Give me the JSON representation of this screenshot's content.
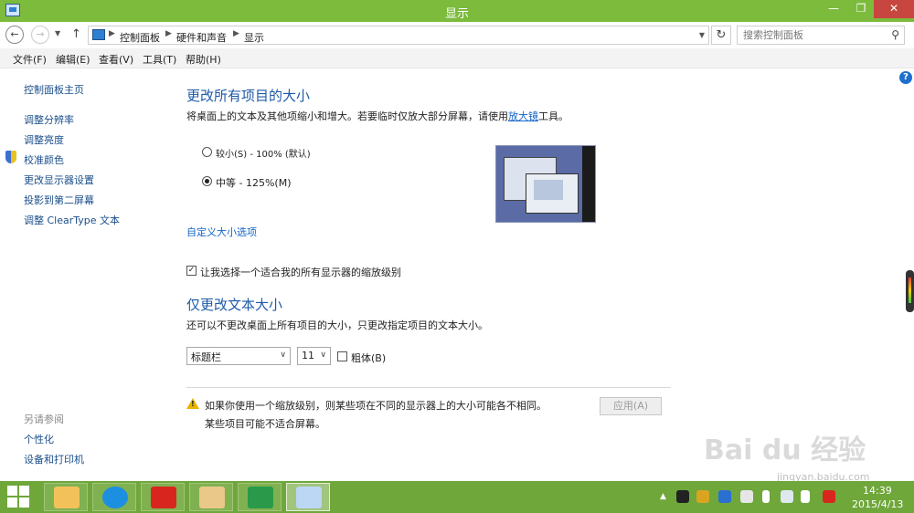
{
  "window": {
    "title": "显示",
    "minimize_glyph": "—",
    "maximize_glyph": "❐",
    "close_glyph": "✕"
  },
  "addressbar": {
    "breadcrumbs": [
      "控制面板",
      "硬件和声音",
      "显示"
    ],
    "search_placeholder": "搜索控制面板"
  },
  "menubar": {
    "items": [
      "文件(F)",
      "编辑(E)",
      "查看(V)",
      "工具(T)",
      "帮助(H)"
    ]
  },
  "sidebar": {
    "home": "控制面板主页",
    "items": [
      "调整分辨率",
      "调整亮度",
      "校准颜色",
      "更改显示器设置",
      "投影到第二屏幕",
      "调整 ClearType 文本"
    ],
    "see_also_title": "另请参阅",
    "see_also": [
      "个性化",
      "设备和打印机"
    ]
  },
  "main": {
    "section1_title": "更改所有项目的大小",
    "section1_desc_prefix": "将桌面上的文本及其他项缩小和增大。若要临时仅放大部分屏幕，请使用",
    "section1_desc_link": "放大镜",
    "section1_desc_suffix": "工具。",
    "option_small": "较小(S) - 100% (默认)",
    "option_medium": "中等 - 125%(M)",
    "selected_option": "medium",
    "custom_link": "自定义大小选项",
    "checkbox_label": "让我选择一个适合我的所有显示器的缩放级别",
    "checkbox_checked": true,
    "section2_title": "仅更改文本大小",
    "section2_desc": "还可以不更改桌面上所有项目的大小，只更改指定项目的文本大小。",
    "item_select_value": "标题栏",
    "size_select_value": "11",
    "bold_label": "粗体(B)",
    "bold_checked": false,
    "warning_line1": "如果你使用一个缩放级别，则某些项在不同的显示器上的大小可能各不相同。",
    "warning_line2": "某些项目可能不适合屏幕。",
    "apply_label": "应用(A)"
  },
  "taskbar": {
    "time": "14:39",
    "date": "2015/4/13"
  },
  "watermark": {
    "text": "Bai du 经验",
    "url": "jingyan.baidu.com"
  },
  "colors": {
    "titlebar": "#7cbb3c",
    "taskbar": "#6fa73a",
    "heading": "#1e5aa8",
    "link": "#1366c8"
  }
}
